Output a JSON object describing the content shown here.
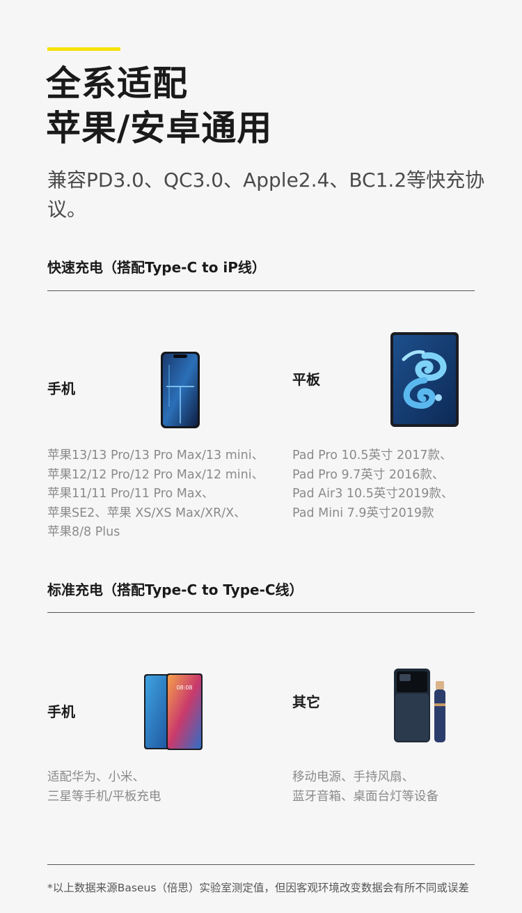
{
  "header": {
    "title_line1": "全系适配",
    "title_line2": "苹果/安卓通用",
    "intro": "兼容PD3.0、QC3.0、Apple2.4、BC1.2等快充协议。"
  },
  "section_fast": {
    "title": "快速充电（搭配Type-C to iP线）",
    "phone": {
      "label": "手机",
      "lines": [
        "苹果13/13 Pro/13 Pro Max/13 mini、",
        "苹果12/12 Pro/12 Pro Max/12 mini、",
        "苹果11/11 Pro/11 Pro Max、",
        "苹果SE2、苹果 XS/XS Max/XR/X、",
        "苹果8/8 Plus"
      ]
    },
    "tablet": {
      "label": "平板",
      "lines": [
        "Pad Pro 10.5英寸 2017款、",
        "Pad Pro 9.7英寸 2016款、",
        "Pad Air3 10.5英寸2019款、",
        "Pad Mini 7.9英寸2019款"
      ]
    }
  },
  "section_standard": {
    "title": "标准充电（搭配Type-C to Type-C线）",
    "phone": {
      "label": "手机",
      "screen_time": "08:08",
      "lines": [
        "适配华为、小米、",
        "三星等手机/平板充电"
      ]
    },
    "other": {
      "label": "其它",
      "lines": [
        "移动电源、手持风扇、",
        "蓝牙音箱、桌面台灯等设备"
      ]
    }
  },
  "footnote": "*以上数据来源Baseus（倍思）实验室测定值，但因客观环境改变数据会有所不同或误差",
  "colors": {
    "accent": "#f7e100",
    "background": "#f6f6f6",
    "text_primary": "#1a1a1a",
    "text_secondary": "#8a8a8a"
  }
}
